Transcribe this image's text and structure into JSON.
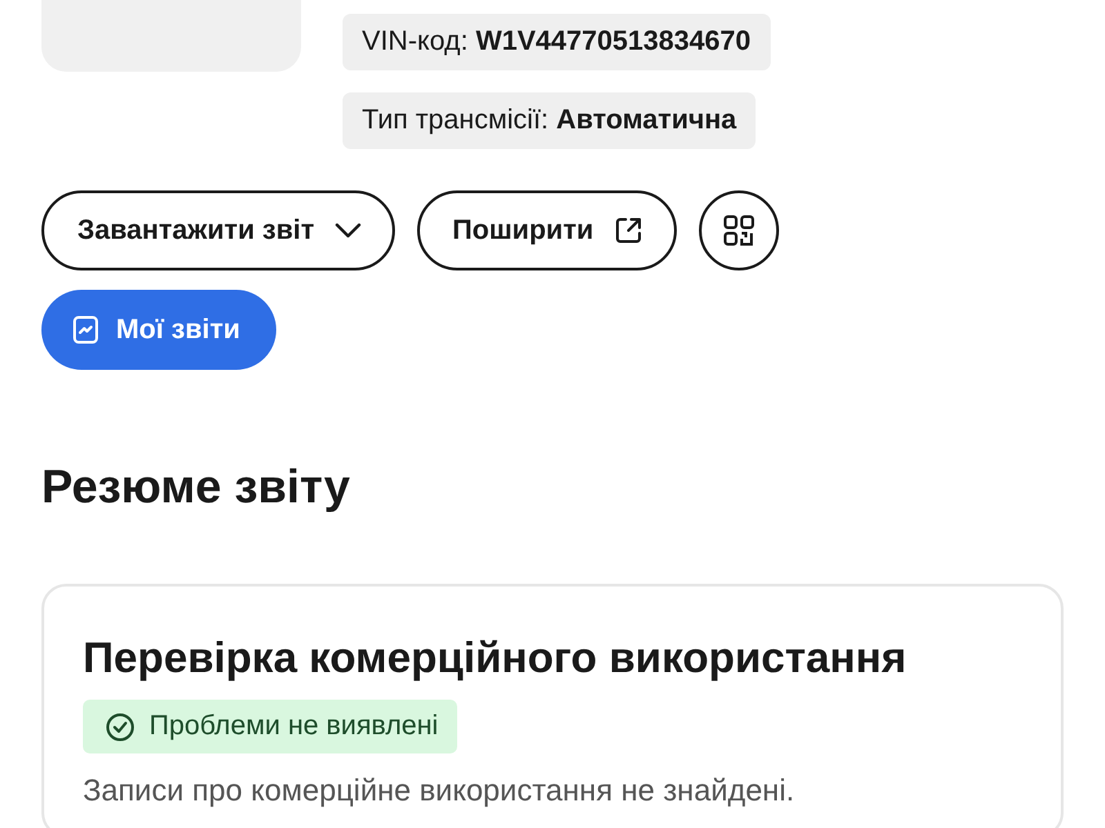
{
  "vehicle_info": [
    {
      "text": "VIN-код: **W1V44770513834670**"
    },
    {
      "text": "Тип трансмісії: **Автоматична**"
    }
  ],
  "actions": [
    {
      "kind": "dropdown",
      "label": "Завантажити звіт"
    },
    {
      "kind": "share",
      "label": "Поширити"
    },
    {
      "kind": "qr"
    }
  ],
  "my_reports_button": {
    "label": "Мої звіти"
  },
  "section_title": "Резюме звіту",
  "card": {
    "title": "Перевірка комерційного використання",
    "status": {
      "label": "Проблеми не виявлені",
      "ok": true
    },
    "text": "Записи про комерційне використання не знайдені."
  }
}
